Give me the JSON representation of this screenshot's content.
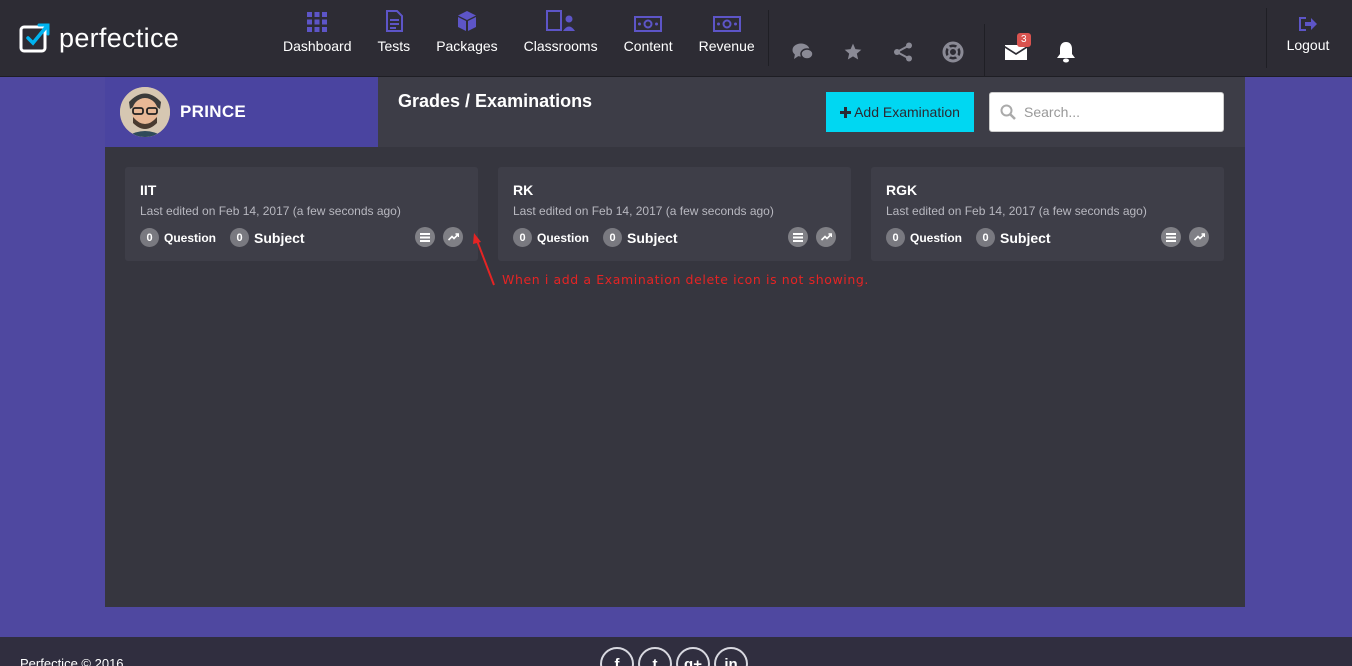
{
  "brand": {
    "name": "perfectice",
    "icon": "external-link-checkbox-icon",
    "accent": "#00b4f0"
  },
  "nav": [
    {
      "label": "Dashboard",
      "icon": "grid-icon"
    },
    {
      "label": "Tests",
      "icon": "document-icon"
    },
    {
      "label": "Packages",
      "icon": "cube-icon"
    },
    {
      "label": "Classrooms",
      "icon": "classroom-icon"
    },
    {
      "label": "Content",
      "icon": "money-icon"
    },
    {
      "label": "Revenue",
      "icon": "money-icon"
    }
  ],
  "icon_nav": {
    "chat": "chat-icon",
    "favorites": "star-icon",
    "share": "share-icon",
    "support": "lifebuoy-icon",
    "messages": "envelope-icon",
    "messages_badge": "3",
    "notifications": "bell-icon"
  },
  "logout": {
    "label": "Logout",
    "icon": "sign-out-icon"
  },
  "profile": {
    "name": "PRINCE"
  },
  "page": {
    "title": "Grades / Examinations",
    "add_button": "Add Examination",
    "search_placeholder": "Search..."
  },
  "cards": [
    {
      "title": "IIT",
      "meta": "Last edited on Feb 14, 2017 (a few seconds ago)",
      "question_count": "0",
      "question_label": "Question",
      "subject_count": "0",
      "subject_label": "Subject"
    },
    {
      "title": "RK",
      "meta": "Last edited on Feb 14, 2017 (a few seconds ago)",
      "question_count": "0",
      "question_label": "Question",
      "subject_count": "0",
      "subject_label": "Subject"
    },
    {
      "title": "RGK",
      "meta": "Last edited on Feb 14, 2017 (a few seconds ago)",
      "question_count": "0",
      "question_label": "Question",
      "subject_count": "0",
      "subject_label": "Subject"
    }
  ],
  "annotation": "When i add a Examination delete icon is not showing.",
  "footer": {
    "copyright": "Perfectice © 2016",
    "social": [
      "f",
      "t",
      "g+",
      "in"
    ]
  },
  "colors": {
    "page_bg": "#4f48a0",
    "topbar": "#2d2c34",
    "panel": "#36363f",
    "card": "#3e3e48",
    "button": "#00d7f2",
    "badge": "#d9534f",
    "annotation": "#e52424"
  }
}
